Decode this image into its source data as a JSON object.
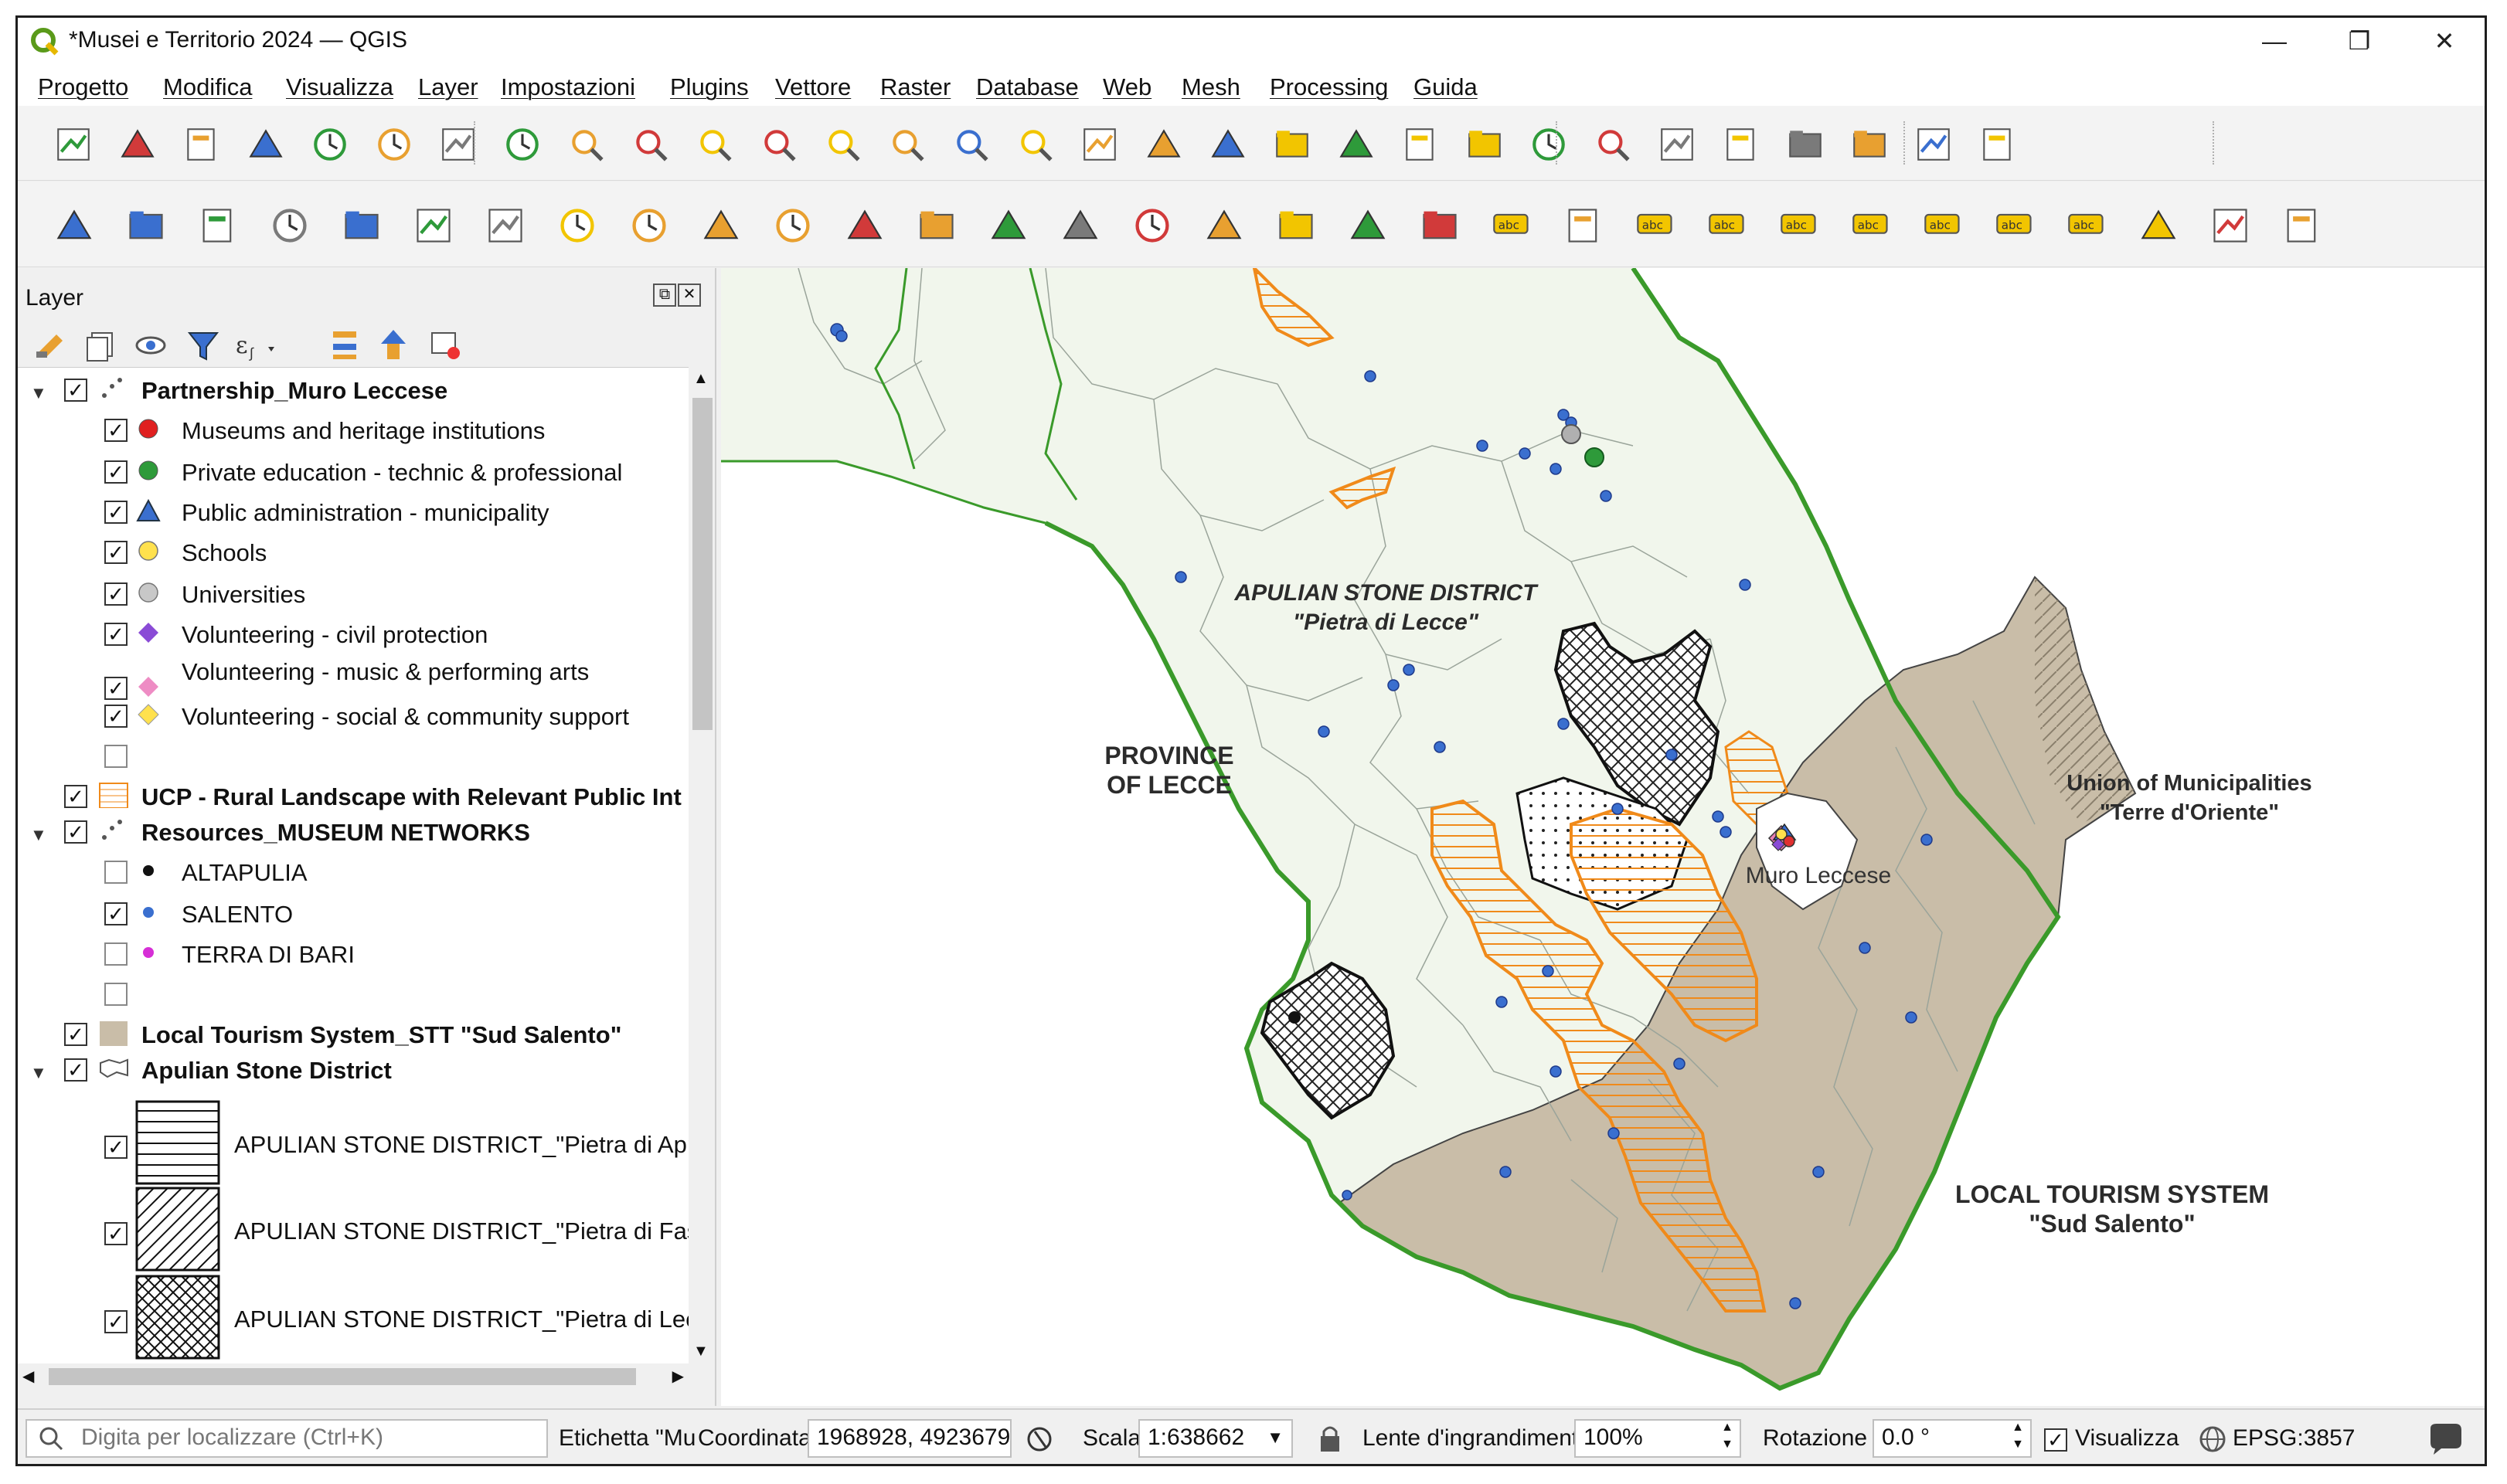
{
  "window": {
    "title": "*Musei e Territorio 2024 — QGIS",
    "minimize": "—",
    "restore": "❐",
    "close": "✕"
  },
  "menu": [
    "Progetto",
    "Modifica",
    "Visualizza",
    "Layer",
    "Impostazioni",
    "Plugins",
    "Vettore",
    "Raster",
    "Database",
    "Web",
    "Mesh",
    "Processing",
    "Guida"
  ],
  "toolbar_icons_row1": [
    "new-project-icon",
    "open-project-icon",
    "save-project-icon",
    "save-as-icon",
    "print-layout-icon",
    "style-manager-icon",
    "pan-icon",
    "pan-to-selection-icon",
    "zoom-in-icon",
    "zoom-out-icon",
    "zoom-full-icon",
    "zoom-to-selection-icon",
    "zoom-to-layer-icon",
    "zoom-native-icon",
    "zoom-last-icon",
    "zoom-next-icon",
    "new-bookmark-icon",
    "show-bookmarks-icon",
    "temporal-icon",
    "refresh-icon",
    "select-features-icon",
    "attribute-table-icon",
    "deselect-icon",
    "select-location-icon",
    "identify-icon",
    "statistics-icon",
    "processing-toolbox-icon",
    "sum-icon",
    "attribute-form-icon",
    "measure-icon",
    "more-icon"
  ],
  "toolbar_icons_row2": [
    "data-source-manager-icon",
    "new-geopackage-icon",
    "new-shapefile-icon",
    "new-spatialite-icon",
    "new-virtual-layer-icon",
    "new-mesh-icon",
    "new-temp-layer-icon",
    "edits-icon",
    "toggle-editing-icon",
    "save-edits-icon",
    "digitize-icon",
    "add-polygon-icon",
    "vertex-tool-icon",
    "modify-attributes-icon",
    "delete-selected-icon",
    "cut-icon",
    "copy-icon",
    "paste-icon",
    "undo-icon",
    "redo-icon",
    "label-tool-icon",
    "diagram-icon",
    "pin-label-icon",
    "highlight-label-icon",
    "move-label-icon",
    "show-label-icon",
    "rotate-label-icon",
    "change-label-icon",
    "label-props-icon",
    "metasearch-icon",
    "python-icon",
    "help-icon"
  ],
  "panel": {
    "title": "Layer"
  },
  "layers": [
    {
      "label": "Partnership_Muro Leccese",
      "bold": true,
      "checked": true,
      "expand": true,
      "symbol": "points-icon",
      "indent": 0
    },
    {
      "label": "Museums and heritage institutions",
      "checked": true,
      "symbol": "red-dot",
      "indent": 1
    },
    {
      "label": "Private education - technic & professional",
      "checked": true,
      "symbol": "green-dot",
      "indent": 1
    },
    {
      "label": "Public administration - municipality",
      "checked": true,
      "symbol": "blue-triangle",
      "indent": 1
    },
    {
      "label": "Schools",
      "checked": true,
      "symbol": "yellow-dot",
      "indent": 1
    },
    {
      "label": "Universities",
      "checked": true,
      "symbol": "grey-dot",
      "indent": 1
    },
    {
      "label": "Volunteering - civil protection",
      "checked": true,
      "symbol": "purple-diamond",
      "indent": 1
    },
    {
      "label": "Volunteering - music & performing arts",
      "checked": true,
      "symbol": "pink-diamond",
      "indent": 1
    },
    {
      "label": "Volunteering - social & community support",
      "checked": true,
      "symbol": "yellow-diamond",
      "indent": 1
    },
    {
      "label": "",
      "checked": false,
      "symbol": "",
      "indent": 1
    },
    {
      "label": "UCP - Rural Landscape with Relevant Public Int",
      "bold": true,
      "checked": true,
      "symbol": "orange-hatch",
      "indent": 0
    },
    {
      "label": "Resources_MUSEUM NETWORKS",
      "bold": true,
      "checked": true,
      "expand": true,
      "symbol": "points-icon",
      "indent": 0
    },
    {
      "label": "ALTAPULIA",
      "checked": false,
      "symbol": "black-dot",
      "indent": 1
    },
    {
      "label": "SALENTO",
      "checked": true,
      "symbol": "blue-dot",
      "indent": 1
    },
    {
      "label": "TERRA DI BARI",
      "checked": false,
      "symbol": "magenta-dot",
      "indent": 1
    },
    {
      "label": "",
      "checked": false,
      "symbol": "",
      "indent": 1
    },
    {
      "label": "Local Tourism System_STT \"Sud Salento\"",
      "bold": true,
      "checked": true,
      "symbol": "tan-box",
      "indent": 0
    },
    {
      "label": "Apulian Stone District",
      "bold": true,
      "checked": true,
      "expand": true,
      "symbol": "polygon-icon",
      "indent": 0
    },
    {
      "label": "APULIAN STONE DISTRICT_\"Pietra di Apri",
      "checked": true,
      "symbol": "horizontal-hatch",
      "indent": 1
    },
    {
      "label": "APULIAN STONE DISTRICT_\"Pietra di Fasa",
      "checked": true,
      "symbol": "diagonal-hatch",
      "indent": 1
    },
    {
      "label": "APULIAN STONE DISTRICT_\"Pietra di Lecc",
      "checked": true,
      "symbol": "cross-hatch",
      "indent": 1
    }
  ],
  "map_labels": {
    "apulian_1": "APULIAN STONE DISTRICT",
    "apulian_2": "\"Pietra di Lecce\"",
    "province_1": "PROVINCE",
    "province_2": "OF LECCE",
    "union_1": "Union of Municipalities",
    "union_2": "\"Terre d'Oriente\"",
    "muro": "Muro Leccese",
    "lts_1": "LOCAL TOURISM SYSTEM",
    "lts_2": "\"Sud Salento\""
  },
  "status": {
    "search_placeholder": "Digita per localizzare (Ctrl+K)",
    "etichetta": "Etichetta \"Mu",
    "coord_label": "Coordinata",
    "coord_value": "1968928, 4923679",
    "scale_label": "Scala",
    "scale_value": "1:638662",
    "magnifier_label": "Lente d'ingrandimento",
    "magnifier_value": "100%",
    "rotation_label": "Rotazione",
    "rotation_value": "0.0 °",
    "render_label": "Visualizza",
    "crs": "EPSG:3857"
  },
  "colors": {
    "land": "#f1f6ec",
    "coast": "#3a9a2a",
    "tourism": "#c9bda8",
    "orange": "#f08a1a",
    "point": "#3a6fcf"
  }
}
